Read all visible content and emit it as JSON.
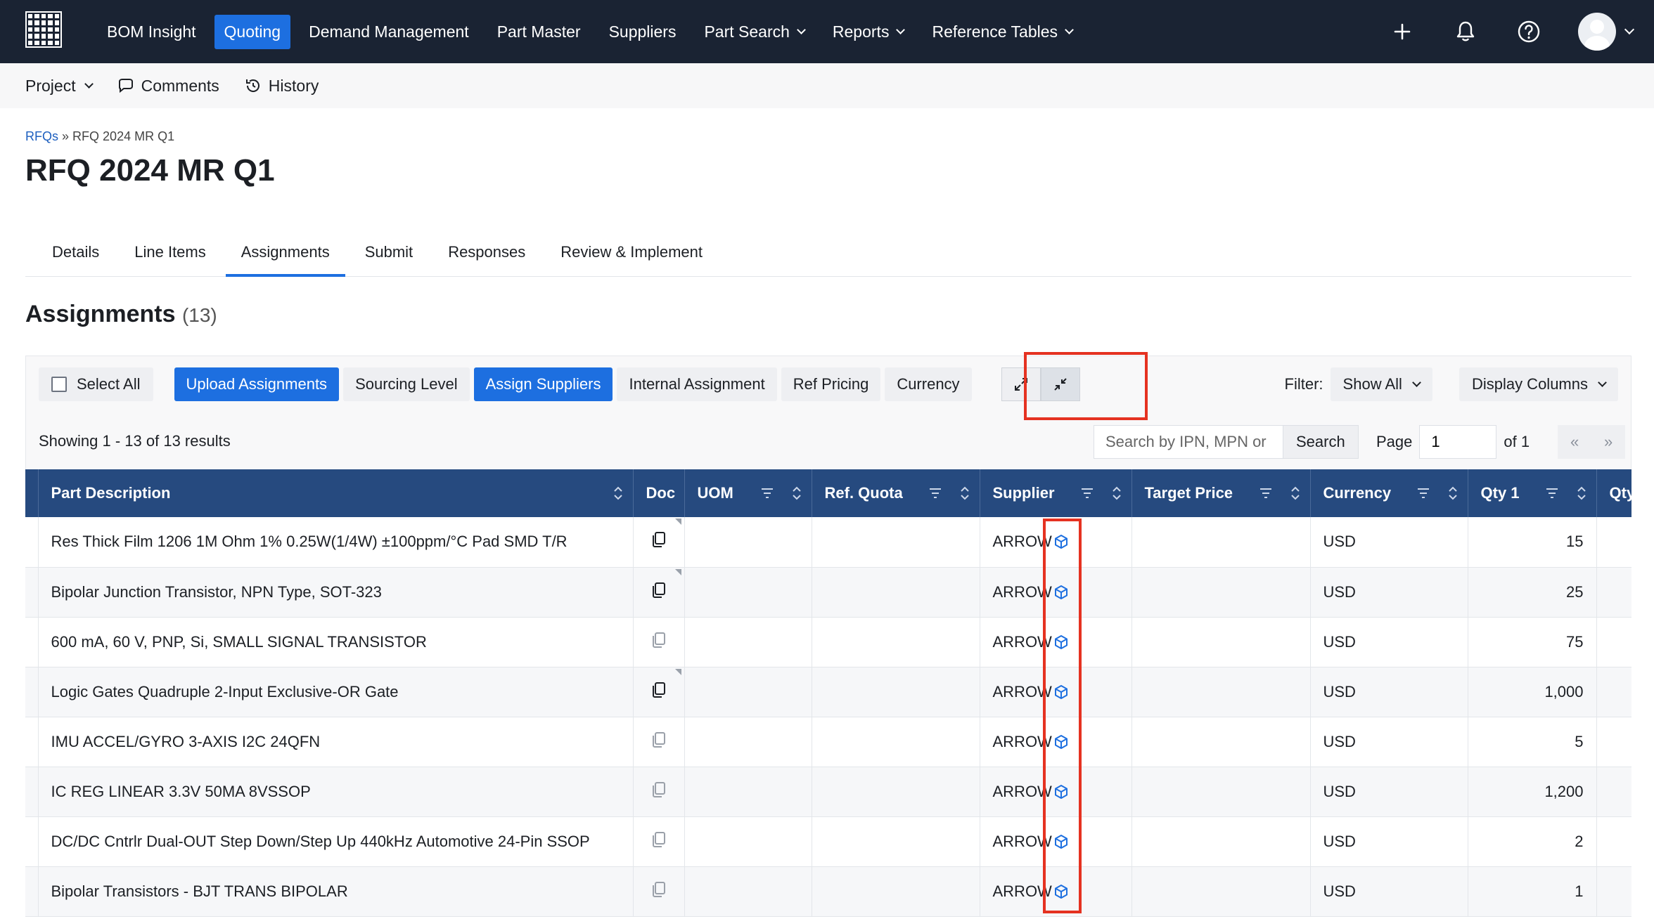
{
  "nav": {
    "items": [
      {
        "label": "BOM Insight",
        "active": false,
        "dropdown": false
      },
      {
        "label": "Quoting",
        "active": true,
        "dropdown": false
      },
      {
        "label": "Demand Management",
        "active": false,
        "dropdown": false
      },
      {
        "label": "Part Master",
        "active": false,
        "dropdown": false
      },
      {
        "label": "Suppliers",
        "active": false,
        "dropdown": false
      },
      {
        "label": "Part Search",
        "active": false,
        "dropdown": true
      },
      {
        "label": "Reports",
        "active": false,
        "dropdown": true
      },
      {
        "label": "Reference Tables",
        "active": false,
        "dropdown": true
      }
    ],
    "right_icons": [
      "plus-icon",
      "bell-icon",
      "help-icon",
      "avatar"
    ]
  },
  "subnav": {
    "project": "Project",
    "comments": "Comments",
    "history": "History"
  },
  "breadcrumb": {
    "root": "RFQs",
    "separator": "»",
    "current": "RFQ 2024 MR Q1"
  },
  "page_title": "RFQ 2024 MR Q1",
  "tabs": [
    {
      "label": "Details",
      "active": false
    },
    {
      "label": "Line Items",
      "active": false
    },
    {
      "label": "Assignments",
      "active": true
    },
    {
      "label": "Submit",
      "active": false
    },
    {
      "label": "Responses",
      "active": false
    },
    {
      "label": "Review & Implement",
      "active": false
    }
  ],
  "section": {
    "title": "Assignments",
    "count": "(13)"
  },
  "toolbar": {
    "select_all": "Select All",
    "upload": "Upload Assignments",
    "sourcing_level": "Sourcing Level",
    "assign_suppliers": "Assign Suppliers",
    "internal_assignment": "Internal Assignment",
    "ref_pricing": "Ref Pricing",
    "currency": "Currency",
    "filter_label": "Filter:",
    "filter_value": "Show All",
    "display_columns": "Display Columns"
  },
  "results": {
    "showing": "Showing 1 - 13 of 13 results",
    "search_placeholder": "Search by IPN, MPN or",
    "search_button": "Search",
    "page_label": "Page",
    "page_value": "1",
    "page_of": "of 1",
    "prev": "«",
    "next": "»"
  },
  "table": {
    "headers": {
      "part_description": "Part Description",
      "doc": "Doc",
      "uom": "UOM",
      "ref_quota": "Ref. Quota",
      "supplier": "Supplier",
      "target_price": "Target Price",
      "currency": "Currency",
      "qty1": "Qty 1",
      "qty_next": "Qty"
    },
    "rows": [
      {
        "desc": "Res Thick Film 1206 1M Ohm 1% 0.25W(1/4W) ±100ppm/°C Pad SMD T/R",
        "doc_active": true,
        "uom": "",
        "ref_quota": "",
        "supplier": "ARROW",
        "target_price": "",
        "currency": "USD",
        "qty1": "15"
      },
      {
        "desc": "Bipolar Junction Transistor, NPN Type, SOT-323",
        "doc_active": true,
        "uom": "",
        "ref_quota": "",
        "supplier": "ARROW",
        "target_price": "",
        "currency": "USD",
        "qty1": "25"
      },
      {
        "desc": "600 mA, 60 V, PNP, Si, SMALL SIGNAL TRANSISTOR",
        "doc_active": false,
        "uom": "",
        "ref_quota": "",
        "supplier": "ARROW",
        "target_price": "",
        "currency": "USD",
        "qty1": "75"
      },
      {
        "desc": "Logic Gates Quadruple 2-Input Exclusive-OR Gate",
        "doc_active": true,
        "uom": "",
        "ref_quota": "",
        "supplier": "ARROW",
        "target_price": "",
        "currency": "USD",
        "qty1": "1,000"
      },
      {
        "desc": "IMU ACCEL/GYRO 3-AXIS I2C 24QFN",
        "doc_active": false,
        "uom": "",
        "ref_quota": "",
        "supplier": "ARROW",
        "target_price": "",
        "currency": "USD",
        "qty1": "5"
      },
      {
        "desc": "IC REG LINEAR 3.3V 50MA 8VSSOP",
        "doc_active": false,
        "uom": "",
        "ref_quota": "",
        "supplier": "ARROW",
        "target_price": "",
        "currency": "USD",
        "qty1": "1,200"
      },
      {
        "desc": "DC/DC Cntrlr Dual-OUT Step Down/Step Up 440kHz Automotive 24-Pin SSOP",
        "doc_active": false,
        "uom": "",
        "ref_quota": "",
        "supplier": "ARROW",
        "target_price": "",
        "currency": "USD",
        "qty1": "2"
      },
      {
        "desc": "Bipolar Transistors - BJT TRANS BIPOLAR",
        "doc_active": false,
        "uom": "",
        "ref_quota": "",
        "supplier": "ARROW",
        "target_price": "",
        "currency": "USD",
        "qty1": "1"
      }
    ]
  },
  "colors": {
    "nav_bg": "#1a2333",
    "accent": "#1d6fe0",
    "table_header": "#264a7f",
    "highlight": "#e53221"
  }
}
